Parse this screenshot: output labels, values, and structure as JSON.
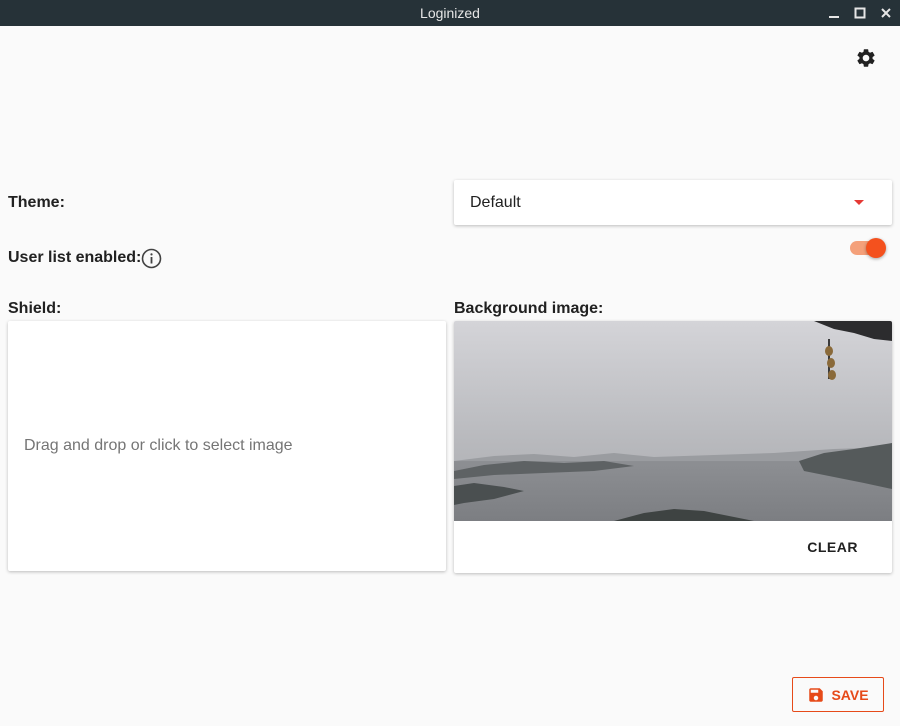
{
  "window": {
    "title": "Loginized",
    "controls": [
      "minimize-icon",
      "maximize-icon",
      "close-icon"
    ]
  },
  "toolbar": {
    "settings_icon": "gear-icon"
  },
  "theme": {
    "label": "Theme:",
    "selected": "Default"
  },
  "user_list": {
    "label": "User list enabled:",
    "enabled": true,
    "info_icon": "info-icon"
  },
  "shield": {
    "label": "Shield:",
    "placeholder": "Drag and drop or click to select image"
  },
  "background": {
    "label": "Background image:",
    "clear_label": "CLEAR"
  },
  "actions": {
    "save_label": "SAVE",
    "save_icon": "floppy-disk-icon"
  },
  "colors": {
    "accent": "#f4511e",
    "titlebar": "#263238",
    "save": "#e64a19",
    "dropdown_arrow": "#e53935"
  }
}
